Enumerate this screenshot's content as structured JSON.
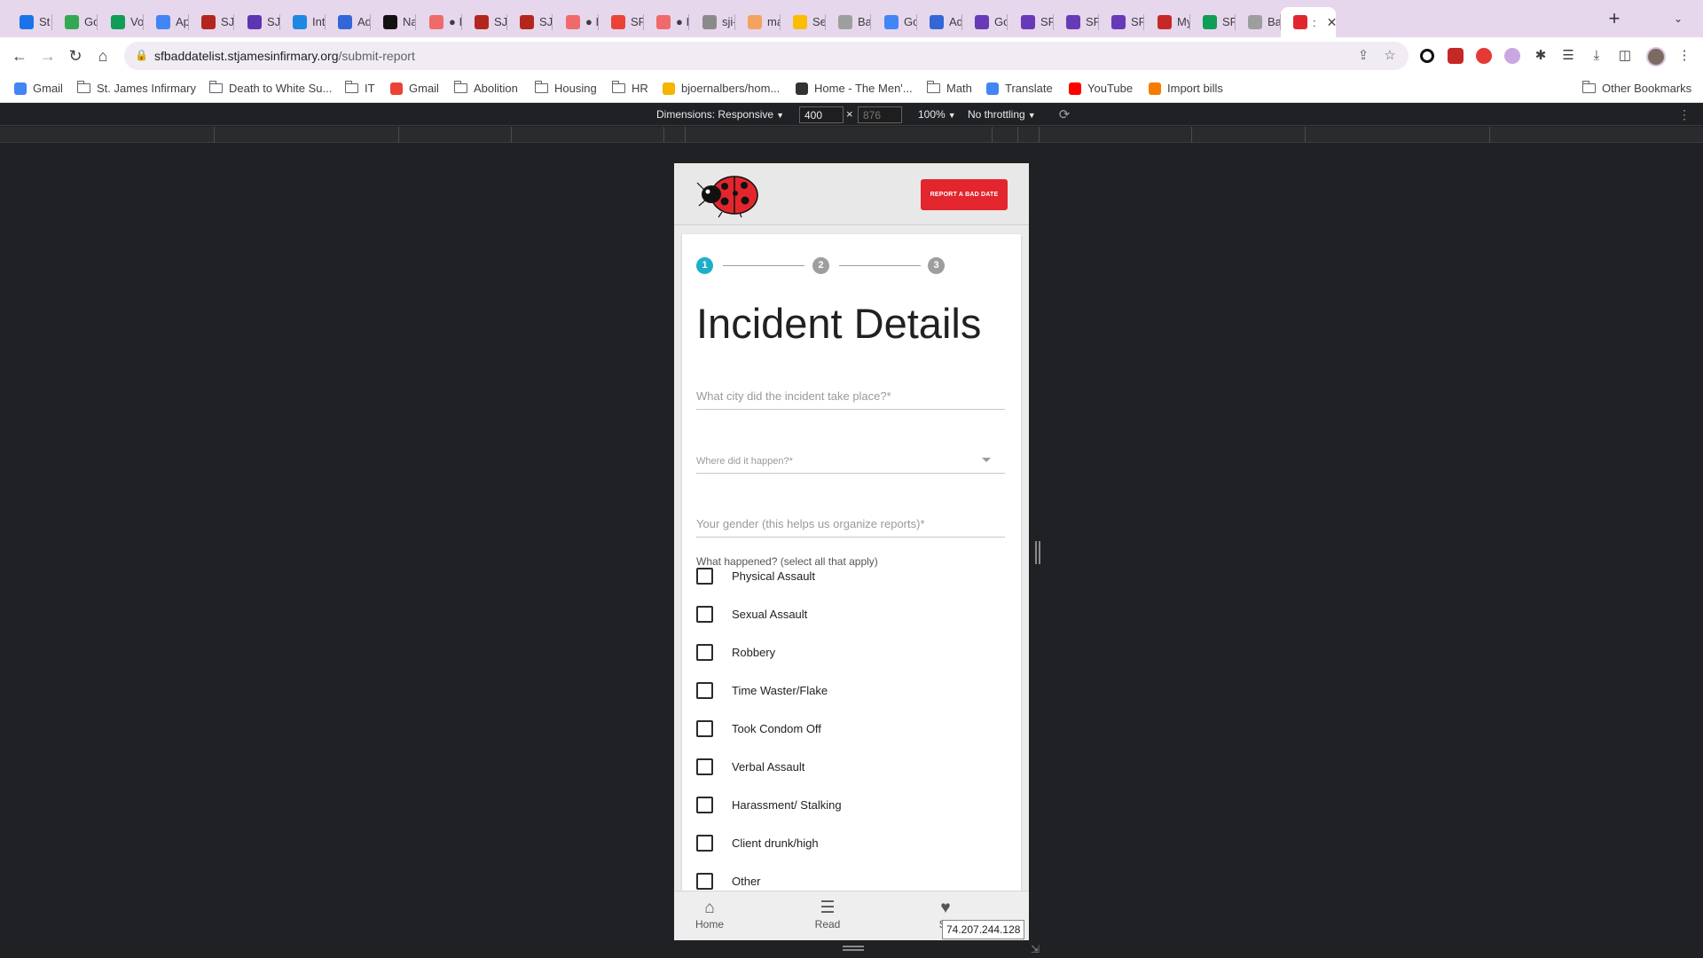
{
  "browser": {
    "tabs": [
      {
        "label": "St J",
        "color": "#1a73e8"
      },
      {
        "label": "Goo",
        "color": "#34a853"
      },
      {
        "label": "Voic",
        "color": "#0f9d58"
      },
      {
        "label": "App",
        "color": "#4285f4"
      },
      {
        "label": "SJI'",
        "color": "#b3261e"
      },
      {
        "label": "SJI'",
        "color": "#5e35b1"
      },
      {
        "label": "Intu",
        "color": "#1e88e5"
      },
      {
        "label": "Adn",
        "color": "#3367d6"
      },
      {
        "label": "Nag",
        "color": "#111111"
      },
      {
        "label": "● I'",
        "color": "#f06a6a"
      },
      {
        "label": "SJI'",
        "color": "#b3261e"
      },
      {
        "label": "SJI'",
        "color": "#b3261e"
      },
      {
        "label": "● I'",
        "color": "#f06a6a"
      },
      {
        "label": "SF I",
        "color": "#ea4335"
      },
      {
        "label": "● I'",
        "color": "#f06a6a"
      },
      {
        "label": "sji-l",
        "color": "#8a8a8a"
      },
      {
        "label": "mar",
        "color": "#f4a261"
      },
      {
        "label": "Sea",
        "color": "#fbbc04"
      },
      {
        "label": "Bad",
        "color": "#9e9e9e"
      },
      {
        "label": "Goo",
        "color": "#4285f4"
      },
      {
        "label": "Adn",
        "color": "#3367d6"
      },
      {
        "label": "Goo",
        "color": "#673ab7"
      },
      {
        "label": "SF I",
        "color": "#673ab7"
      },
      {
        "label": "SF I",
        "color": "#673ab7"
      },
      {
        "label": "SF I",
        "color": "#673ab7"
      },
      {
        "label": "My",
        "color": "#c62828"
      },
      {
        "label": "SF I",
        "color": "#0f9d58"
      },
      {
        "label": "Bad",
        "color": "#9e9e9e"
      },
      {
        "label": ":",
        "color": "#e3262d"
      }
    ],
    "new_tab_symbol": "+",
    "url_domain": "sfbaddatelist.stjamesinfirmary.org",
    "url_path": "/submit-report",
    "bookmarks": [
      {
        "label": "Gmail",
        "type": "google-icon",
        "color": "#4285f4"
      },
      {
        "label": "St. James Infirmary",
        "type": "folder"
      },
      {
        "label": "Death to White Su...",
        "type": "folder"
      },
      {
        "label": "IT",
        "type": "folder"
      },
      {
        "label": "Gmail",
        "type": "gmail-icon",
        "color": "#ea4335"
      },
      {
        "label": "Abolition",
        "type": "folder"
      },
      {
        "label": "Housing",
        "type": "folder"
      },
      {
        "label": "HR",
        "type": "folder"
      },
      {
        "label": "bjoernalbers/hom...",
        "type": "bolt-icon",
        "color": "#f4b400"
      },
      {
        "label": "Home - The Men'...",
        "type": "site-icon",
        "color": "#333333"
      },
      {
        "label": "Math",
        "type": "folder"
      },
      {
        "label": "Translate",
        "type": "translate-icon",
        "color": "#4285f4"
      },
      {
        "label": "YouTube",
        "type": "youtube-icon",
        "color": "#ff0000"
      },
      {
        "label": "Import bills",
        "type": "bills-icon",
        "color": "#f57c00"
      }
    ],
    "other_bookmarks": "Other Bookmarks"
  },
  "devtools": {
    "dimensions_label": "Dimensions: Responsive",
    "width_value": "400",
    "height_value": "876",
    "times": "×",
    "zoom": "100%",
    "throttling": "No throttling"
  },
  "site": {
    "report_button": "REPORT A BAD DATE",
    "steps": [
      "1",
      "2",
      "3"
    ],
    "title": "Incident Details",
    "city_placeholder": "What city did the incident take place?*",
    "where_placeholder": "Where did it happen?*",
    "gender_placeholder": "Your gender (this helps us organize reports)*",
    "checkbox_group_label": "What happened? (select all that apply)",
    "options": [
      "Physical Assault",
      "Sexual Assault",
      "Robbery",
      "Time Waster/Flake",
      "Took Condom Off",
      "Verbal Assault",
      "Harassment/ Stalking",
      "Client drunk/high",
      "Other"
    ],
    "bottom_nav": {
      "home": "Home",
      "read": "Read",
      "submit": "Su"
    },
    "ip_tooltip": "74.207.244.128"
  },
  "colors": {
    "accent_step": "#1eaecb",
    "report_button": "#e3262d",
    "tab_strip": "#e6d7ec"
  }
}
